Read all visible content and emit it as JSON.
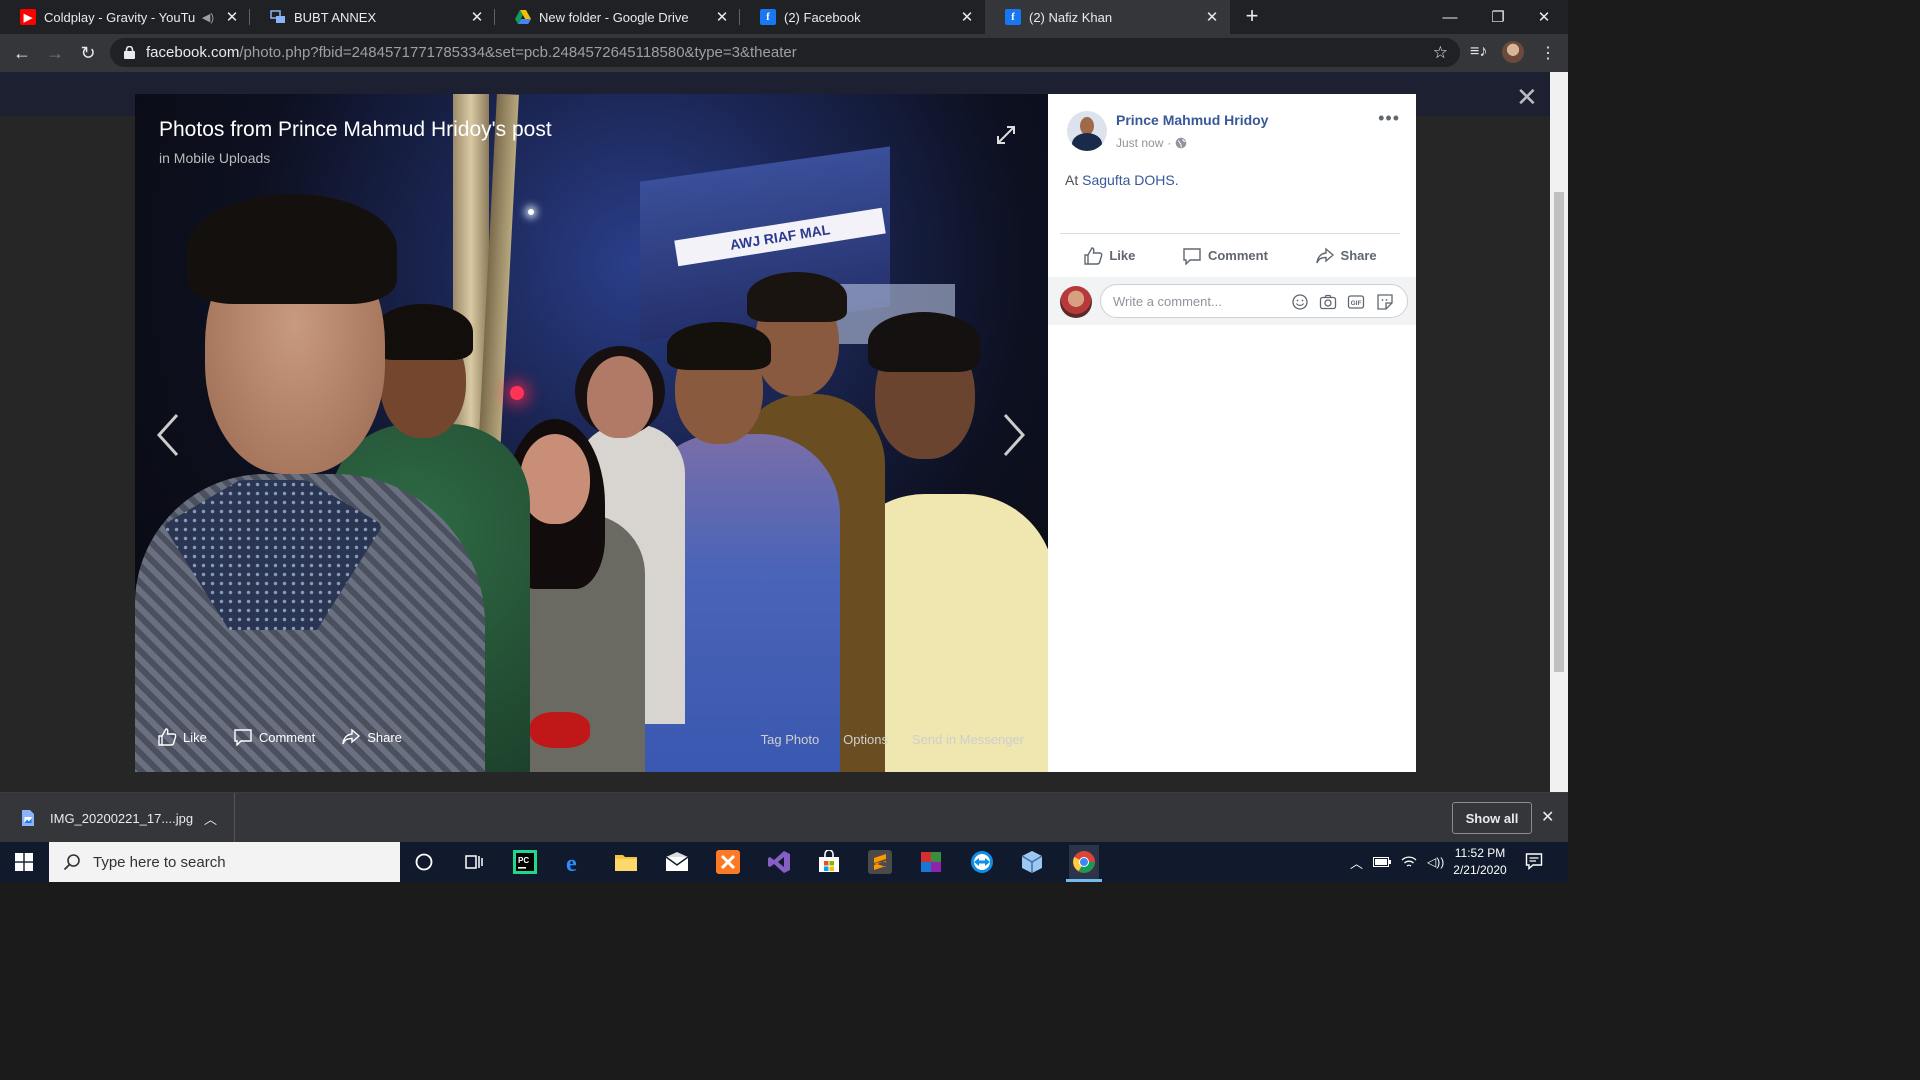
{
  "tabs": [
    {
      "title": "Coldplay - Gravity - YouTube",
      "icon": "youtube-icon",
      "audio": true
    },
    {
      "title": "BUBT ANNEX",
      "icon": "bubt-icon"
    },
    {
      "title": "New folder - Google Drive",
      "icon": "google-drive-icon"
    },
    {
      "title": "(2) Facebook",
      "icon": "facebook-icon"
    },
    {
      "title": "(2) Nafiz Khan",
      "icon": "facebook-icon",
      "active": true
    }
  ],
  "address_bar": {
    "host": "facebook.com",
    "path": "/photo.php?fbid=2484571771785334&set=pcb.2484572645118580&type=3&theater"
  },
  "theater": {
    "title": "Photos from Prince Mahmud Hridoy's post",
    "subtitle": "in Mobile Uploads",
    "actions": {
      "like": "Like",
      "comment": "Comment",
      "share": "Share"
    },
    "links": {
      "tag_photo": "Tag Photo",
      "options": "Options",
      "send": "Send in Messenger"
    },
    "sign_text": "AWJ RIAF MAL"
  },
  "post": {
    "author": "Prince Mahmud Hridoy",
    "time": "Just now",
    "privacy_icon": "globe-icon",
    "text_prefix": "At",
    "location": "Sagufta DOHS.",
    "actions": {
      "like": "Like",
      "comment": "Comment",
      "share": "Share"
    },
    "comment_placeholder": "Write a comment..."
  },
  "downloads": {
    "file": "IMG_20200221_17....jpg",
    "show_all": "Show all"
  },
  "taskbar": {
    "search_placeholder": "Type here to search",
    "time": "11:52 PM",
    "date": "2/21/2020"
  },
  "colors": {
    "fb_blue": "#385898",
    "chrome_dark": "#202124",
    "chrome_toolbar": "#35363a",
    "taskbar": "#101a2c"
  }
}
